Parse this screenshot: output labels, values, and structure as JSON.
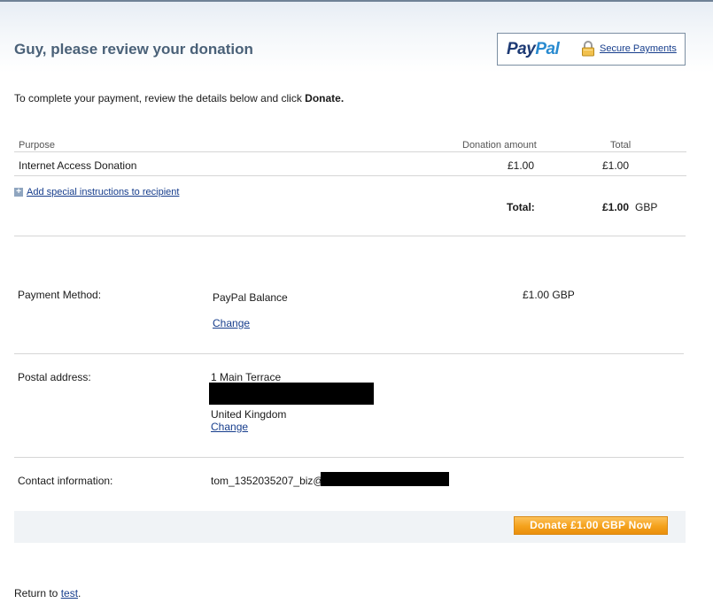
{
  "page": {
    "title": "Guy, please review your donation",
    "intro_text": "To complete your payment, review the details below and click ",
    "intro_emphasis": "Donate."
  },
  "paypal_badge": {
    "logo_pay": "Pay",
    "logo_pal": "Pal",
    "secure_link": "Secure Payments"
  },
  "table": {
    "headers": {
      "purpose": "Purpose",
      "amount": "Donation amount",
      "total": "Total"
    },
    "row": {
      "purpose": "Internet Access Donation",
      "amount": "£1.00",
      "total": "£1.00"
    },
    "add_instructions": "Add special instructions to recipient",
    "total_label": "Total:",
    "total_value": "£1.00",
    "total_currency": "GBP"
  },
  "payment_method": {
    "label": "Payment Method:",
    "value": "PayPal Balance",
    "amount": "£1.00 GBP",
    "change": "Change"
  },
  "postal_address": {
    "label": "Postal address:",
    "line1": "1 Main Terrace",
    "country": "United Kingdom",
    "change": "Change"
  },
  "contact": {
    "label": "Contact information:",
    "email_prefix": "tom_1352035207_biz@"
  },
  "donate_button": "Donate £1.00 GBP Now",
  "footer": {
    "return_text": "Return to ",
    "return_link": "test",
    "return_suffix": "."
  },
  "colors": {
    "title": "#4a6178",
    "link": "#163d8c",
    "button": "#f4a11b",
    "redaction": "#000000"
  }
}
